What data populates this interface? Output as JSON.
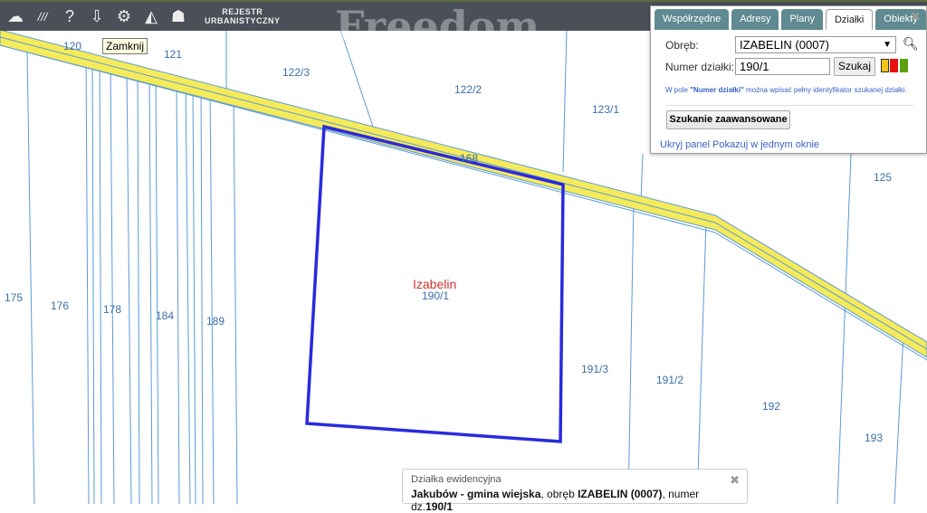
{
  "toolbar": {
    "items": [
      {
        "icon": "map-shape-icon",
        "glyph": "☁"
      },
      {
        "icon": "layers-lines-icon",
        "glyph": "///"
      },
      {
        "icon": "help-icon",
        "glyph": "?"
      },
      {
        "icon": "cloud-download-icon",
        "glyph": "⇩"
      },
      {
        "icon": "settings-gears-icon",
        "glyph": "⚙"
      },
      {
        "icon": "measure-icon",
        "glyph": "◭"
      },
      {
        "icon": "user-chat-icon",
        "glyph": "☗"
      }
    ],
    "brand_line1": "REJESTR",
    "brand_line2": "URBANISTYCZNY"
  },
  "watermark": "Freedom",
  "tooltip": "Zamknij",
  "map": {
    "parcels": [
      "120",
      "121",
      "122/3",
      "122/2",
      "123/1",
      "168",
      "125",
      "175",
      "176",
      "178",
      "184",
      "189",
      "191/3",
      "191/2",
      "192",
      "193"
    ],
    "selected_place": "Izabelin",
    "selected_parcel": "190/1",
    "colors": {
      "road": "#f5ea5a",
      "boundary": "#5b9bd5",
      "selection": "#2a2ae0"
    }
  },
  "panel": {
    "tabs": [
      "Współrzędne",
      "Adresy",
      "Plany",
      "Działki",
      "Obiekty"
    ],
    "active_tab": "Działki",
    "obreb_label": "Obręb:",
    "obreb_value": "IZABELIN (0007)",
    "numer_label": "Numer działki:",
    "numer_value": "190/1",
    "search_button": "Szukaj",
    "hint_prefix": "W pole ",
    "hint_bold": "\"Numer działki\"",
    "hint_suffix": " można wpisać pełny identyfikator szukanej działki.",
    "advanced_button": "Szukanie zaawansowane",
    "hide_link": "Ukryj panel",
    "single_window_link": "Pokazuj w jednym oknie",
    "swatches": [
      "#f5c518",
      "#e81010",
      "#5aa010"
    ]
  },
  "info": {
    "title": "Działka ewidencyjna",
    "place": "Jakubów - gmina wiejska",
    "obreb_text": ", obręb ",
    "obreb": "IZABELIN (0007)",
    "numer_text": ", numer dz.",
    "numer": "190/1"
  }
}
